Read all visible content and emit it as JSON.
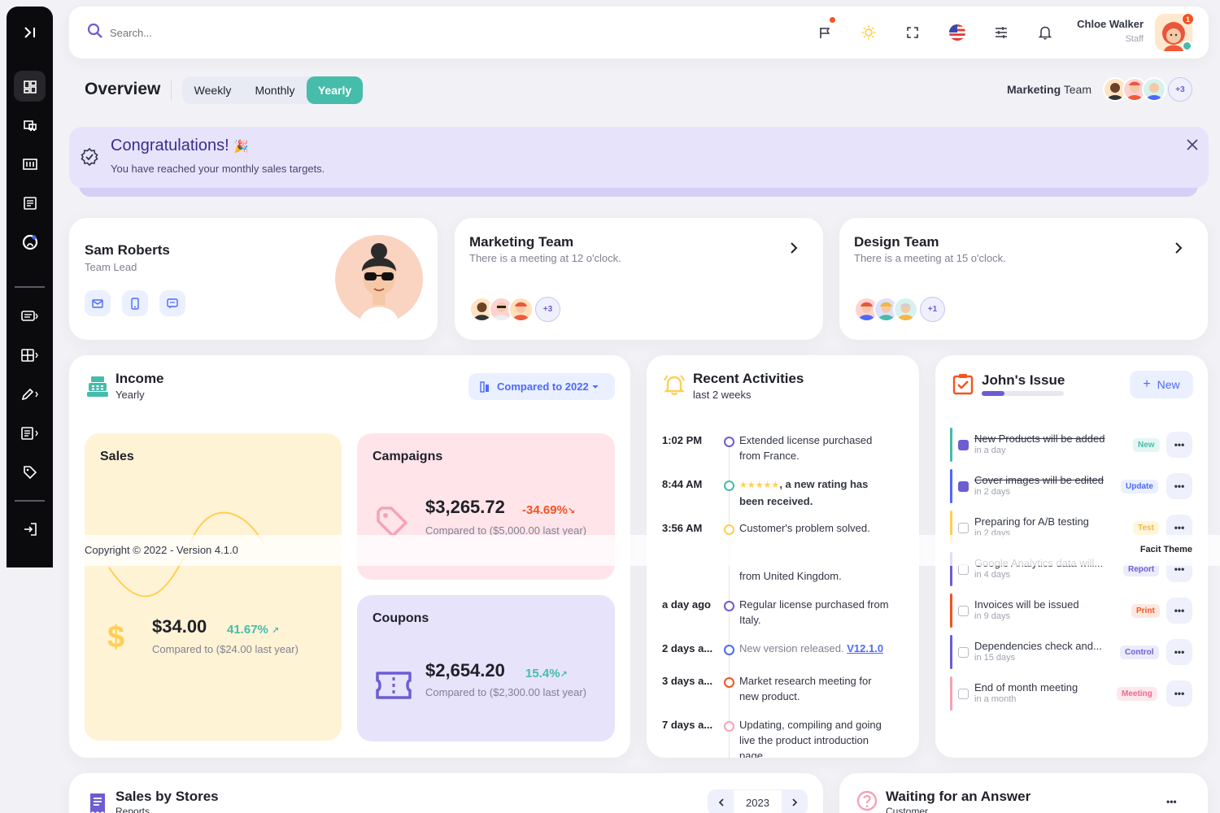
{
  "header": {
    "search_placeholder": "Search...",
    "user_name": "Chloe Walker",
    "user_role": "Staff",
    "notification_count": "1"
  },
  "subheader": {
    "title": "Overview",
    "periods": [
      "Weekly",
      "Monthly",
      "Yearly"
    ],
    "active_period": "Yearly",
    "team_label_bold": "Marketing",
    "team_label_rest": " Team",
    "team_extra": "+3"
  },
  "banner": {
    "title": "Congratulations!",
    "emoji": "🎉",
    "message": "You have reached your monthly sales targets."
  },
  "profile": {
    "name": "Sam Roberts",
    "role": "Team Lead"
  },
  "teams": [
    {
      "title": "Marketing Team",
      "subtitle": "There is a meeting at 12 o'clock.",
      "extra": "+3"
    },
    {
      "title": "Design Team",
      "subtitle": "There is a meeting at 15 o'clock.",
      "extra": "+1"
    }
  ],
  "income": {
    "title": "Income",
    "subtitle": "Yearly",
    "compare_label": "Compared to ",
    "compare_year": "2022",
    "sales": {
      "label": "Sales",
      "value": "$34.00",
      "change": "41.67%",
      "compare": "Compared to ($24.00 last year)"
    },
    "campaigns": {
      "label": "Campaigns",
      "value": "$3,265.72",
      "change": "-34.69%",
      "compare": "Compared to ($5,000.00 last year)"
    },
    "coupons": {
      "label": "Coupons",
      "value": "$2,654.20",
      "change": "15.4%",
      "compare": "Compared to ($2,300.00 last year)"
    }
  },
  "activities": {
    "title": "Recent Activities",
    "subtitle": "last 2 weeks",
    "items": [
      {
        "time": "1:02 PM",
        "text": "Extended license purchased from France."
      },
      {
        "time": "8:44 AM",
        "stars": "★★★★★",
        "text": ", a new rating has been received."
      },
      {
        "time": "3:56 AM",
        "text": "Customer's problem solved."
      },
      {
        "time": "",
        "text": "from United Kingdom."
      },
      {
        "time": "a day ago",
        "text": "Regular license purchased from Italy."
      },
      {
        "time": "2 days a...",
        "text": "New version released. ",
        "link": "V12.1.0"
      },
      {
        "time": "3 days a...",
        "text": "Market research meeting for new product."
      },
      {
        "time": "7 days a...",
        "text": "Updating, compiling and going live the product introduction page."
      }
    ]
  },
  "issues": {
    "title": "John's Issue",
    "new_label": "New",
    "progress": 0.28,
    "items": [
      {
        "title": "New Products will be added",
        "due": "in a day",
        "badge": "New",
        "done": true
      },
      {
        "title": "Cover images will be edited",
        "due": "in 2 days",
        "badge": "Update",
        "done": true
      },
      {
        "title": "Preparing for A/B testing",
        "due": "in 2 days",
        "badge": "Test",
        "done": false
      },
      {
        "title": "Google Analytics data will...",
        "due": "in 4 days",
        "badge": "Report",
        "done": false
      },
      {
        "title": "Invoices will be issued",
        "due": "in 9 days",
        "badge": "Print",
        "done": false
      },
      {
        "title": "Dependencies check and...",
        "due": "in 15 days",
        "badge": "Control",
        "done": false
      },
      {
        "title": "End of month meeting",
        "due": "in a month",
        "badge": "Meeting",
        "done": false
      }
    ]
  },
  "footer": {
    "copyright": "Copyright © 2022 - Version 4.1.0",
    "brand": "Facit Theme"
  },
  "stores": {
    "title": "Sales by Stores",
    "subtitle": "Reports",
    "year": "2023"
  },
  "waiting": {
    "title": "Waiting for an Answer",
    "subtitle": "Customer"
  },
  "colors": {
    "primary": "#6c5dd3",
    "success": "#46bcaa",
    "danger": "#f35421",
    "warning": "#ffcf52",
    "info": "#4d69fa",
    "secondary": "#e83e8c"
  }
}
